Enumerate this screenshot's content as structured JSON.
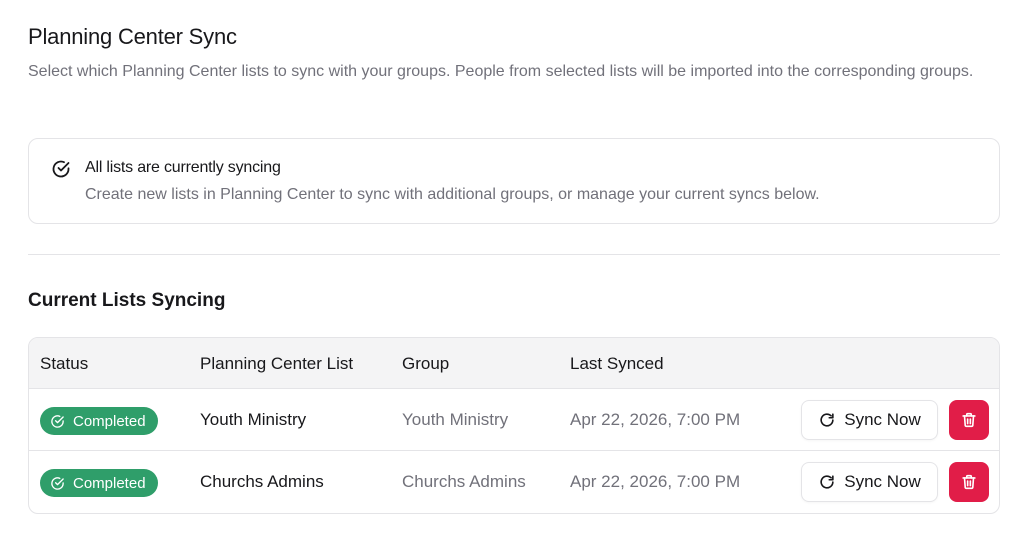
{
  "header": {
    "title": "Planning Center Sync",
    "description": "Select which Planning Center lists to sync with your groups. People from selected lists will be imported into the corresponding groups."
  },
  "alert": {
    "icon": "circle-check-icon",
    "title": "All lists are currently syncing",
    "description": "Create new lists in Planning Center to sync with additional groups, or manage your current syncs below."
  },
  "section": {
    "title": "Current Lists Syncing"
  },
  "table": {
    "columns": {
      "status": "Status",
      "list": "Planning Center List",
      "group": "Group",
      "last_synced": "Last Synced"
    },
    "rows": [
      {
        "status": "Completed",
        "list": "Youth Ministry",
        "group": "Youth Ministry",
        "last_synced": "Apr 22, 2026, 7:00 PM",
        "sync_label": "Sync Now"
      },
      {
        "status": "Completed",
        "list": "Churchs Admins",
        "group": "Churchs Admins",
        "last_synced": "Apr 22, 2026, 7:00 PM",
        "sync_label": "Sync Now"
      }
    ]
  },
  "colors": {
    "status_completed": "#2f9e6a",
    "delete": "#e11d48",
    "muted_text": "#71717a",
    "border": "#e4e4e7"
  }
}
